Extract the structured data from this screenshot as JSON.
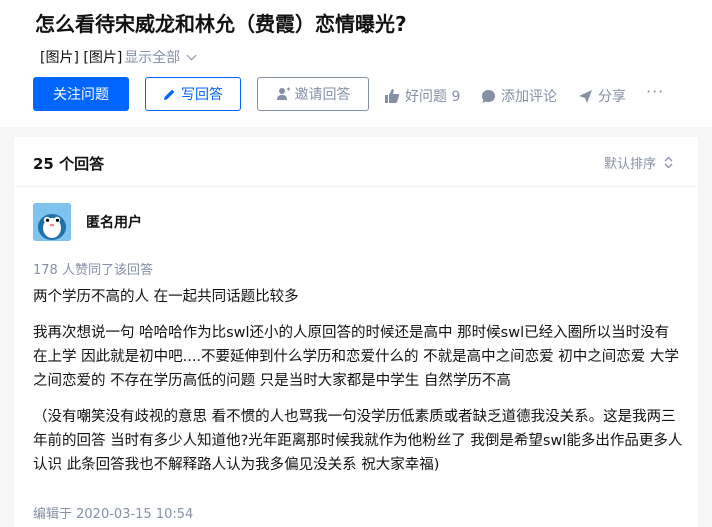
{
  "question": {
    "title": "怎么看待宋威龙和林允（费霞）恋情曝光?",
    "desc_images": "[图片] [图片]",
    "show_all": "显示全部"
  },
  "actions": {
    "follow": "关注问题",
    "write": "写回答",
    "invite": "邀请回答",
    "good_question": "好问题 9",
    "add_comment": "添加评论",
    "share": "分享",
    "more": "···"
  },
  "answers": {
    "count_label": "25 个回答",
    "sort_label": "默认排序"
  },
  "answer": {
    "author": "匿名用户",
    "voters": "178 人赞同了该回答",
    "paragraphs": [
      "两个学历不高的人 在一起共同话题比较多",
      "我再次想说一句 哈哈哈作为比swl还小的人原回答的时候还是高中 那时候swl已经入圈所以当时没有在上学 因此就是初中吧....不要延伸到什么学历和恋爱什么的 不就是高中之间恋爱 初中之间恋爱 大学之间恋爱的 不存在学历高低的问题 只是当时大家都是中学生 自然学历不高",
      " （没有嘲笑没有歧视的意思 看不惯的人也骂我一句没学历低素质或者缺乏道德我没关系。这是我两三年前的回答 当时有多少人知道他?光年距离那时候我就作为他粉丝了 我倒是希望swl能多出作品更多人认识 此条回答我也不解释路人认为我多偏见没关系 祝大家幸福)"
    ],
    "edited": "编辑于 2020-03-15 10:54"
  },
  "colors": {
    "brand": "#0066ff",
    "muted": "#8590a6"
  }
}
